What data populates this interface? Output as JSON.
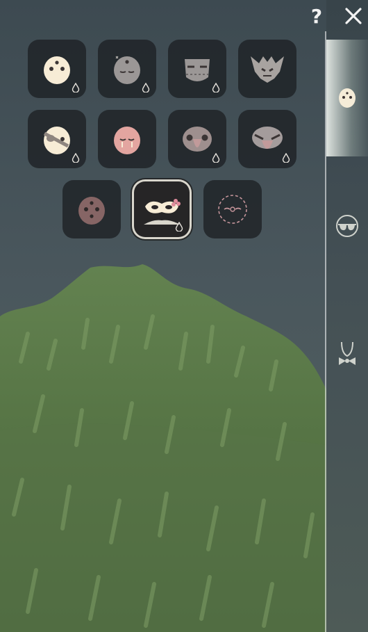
{
  "topbar": {
    "help_label": "?",
    "close_icon": "close-icon"
  },
  "sidebar": {
    "tabs": [
      {
        "id": "mask",
        "icon": "mask-face-icon",
        "active": true
      },
      {
        "id": "accessory",
        "icon": "glasses-icon",
        "active": false
      },
      {
        "id": "neck",
        "icon": "bowtie-necklace-icon",
        "active": false
      }
    ]
  },
  "mask_grid": {
    "items": [
      {
        "icon": "cream-dotted-mask-icon",
        "selected": false,
        "has_dye": true
      },
      {
        "icon": "gray-dotted-mask-icon",
        "selected": false,
        "has_dye": true
      },
      {
        "icon": "gray-bandaged-mask-icon",
        "selected": false,
        "has_dye": true
      },
      {
        "icon": "horned-crown-mask-icon",
        "selected": false,
        "has_dye": false
      },
      {
        "icon": "cream-eyepatch-mask-icon",
        "selected": false,
        "has_dye": true
      },
      {
        "icon": "pink-crying-mask-icon",
        "selected": false,
        "has_dye": false
      },
      {
        "icon": "bird-beak-mask-icon",
        "selected": false,
        "has_dye": true
      },
      {
        "icon": "bird-beak-mask-alt-icon",
        "selected": false,
        "has_dye": true
      },
      {
        "icon": "brown-dotted-mask-icon",
        "selected": false,
        "has_dye": false
      },
      {
        "icon": "masquerade-flower-mask-icon",
        "selected": true,
        "has_dye": true
      },
      {
        "icon": "empty-mask-slot-icon",
        "selected": false,
        "has_dye": false
      }
    ]
  },
  "colors": {
    "panel": "#1e2226",
    "mask_cream": "#f7ecd6",
    "mask_gray": "#9b9796",
    "mask_pink": "#e3a5a0",
    "selection_ring": "#d9d6cc",
    "grass": "#5b7a47"
  }
}
